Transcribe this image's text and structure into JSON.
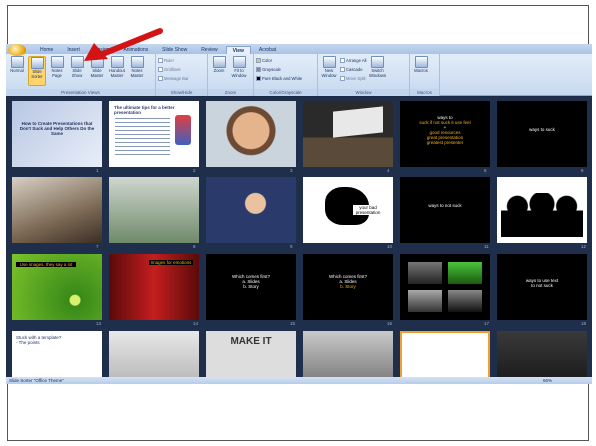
{
  "ribbon": {
    "tabs": [
      "Home",
      "Insert",
      "Design",
      "Animations",
      "Slide Show",
      "Review",
      "View",
      "Acrobat"
    ],
    "active_tab": "View",
    "groups": {
      "presentation_views": {
        "label": "Presentation Views",
        "buttons": [
          "Normal",
          "Slide Sorter",
          "Notes Page",
          "Slide Show",
          "Slide Master",
          "Handout Master",
          "Notes Master"
        ]
      },
      "show_hide": {
        "label": "Show/Hide",
        "items": [
          "Ruler",
          "Gridlines",
          "Message Bar"
        ]
      },
      "zoom": {
        "label": "Zoom",
        "buttons": [
          "Zoom",
          "Fit to Window"
        ]
      },
      "color": {
        "label": "Color/Grayscale",
        "items": [
          "Color",
          "Grayscale",
          "Pure Black and White"
        ]
      },
      "window": {
        "label": "Window",
        "new_window": "New Window",
        "items": [
          "Arrange All",
          "Cascade",
          "Move Split"
        ],
        "switch": "Switch Windows"
      },
      "macros": {
        "label": "Macros",
        "button": "Macros"
      }
    }
  },
  "slides": [
    {
      "num": "1",
      "type": "title",
      "title": "How to Create Presentations that Don't Suck and Help Others Do the Same"
    },
    {
      "num": "2",
      "type": "text",
      "title": "The ultimate tips for a better presentation"
    },
    {
      "num": "3",
      "type": "photo"
    },
    {
      "num": "4",
      "type": "photo"
    },
    {
      "num": "5",
      "type": "text",
      "lines": [
        "ways to",
        "suck if not suck it use feel",
        "+",
        "good resources",
        "great presentation",
        "greatest presenter"
      ]
    },
    {
      "num": "6",
      "type": "text",
      "lines": [
        "ways to suck"
      ]
    },
    {
      "num": "7",
      "type": "photo"
    },
    {
      "num": "8",
      "type": "photo"
    },
    {
      "num": "9",
      "type": "photo"
    },
    {
      "num": "10",
      "type": "drawing",
      "lines": [
        "your bad presentation"
      ]
    },
    {
      "num": "11",
      "type": "text",
      "lines": [
        "ways to not suck"
      ]
    },
    {
      "num": "12",
      "type": "drawing"
    },
    {
      "num": "13",
      "type": "photo",
      "lines": [
        "Use images, they say a lot"
      ]
    },
    {
      "num": "14",
      "type": "photo",
      "lines": [
        "Images for emotions"
      ]
    },
    {
      "num": "15",
      "type": "text",
      "lines": [
        "Which comes first?",
        "a. Slides",
        "b. Story"
      ]
    },
    {
      "num": "16",
      "type": "text",
      "lines": [
        "Which comes first?",
        "a. Slides",
        "b. Story"
      ]
    },
    {
      "num": "17",
      "type": "photo"
    },
    {
      "num": "18",
      "type": "text",
      "lines": [
        "ways to use text",
        "to not suck"
      ]
    },
    {
      "num": "19",
      "type": "text",
      "lines": [
        "Stuck with a template?",
        "- The points"
      ]
    },
    {
      "num": "20",
      "type": "photo"
    },
    {
      "num": "21",
      "type": "photo",
      "lines": [
        "MAKE IT"
      ]
    },
    {
      "num": "22",
      "type": "photo"
    },
    {
      "num": "23",
      "type": "photo"
    },
    {
      "num": "24",
      "type": "photo"
    }
  ],
  "status": {
    "left": "Slide Sorter   \"Office Theme\"",
    "zoom": "66%"
  },
  "colors": {
    "accent_arrow": "#d41414",
    "highlight": "#f2b21c",
    "ribbon": "#c7d9f0"
  }
}
